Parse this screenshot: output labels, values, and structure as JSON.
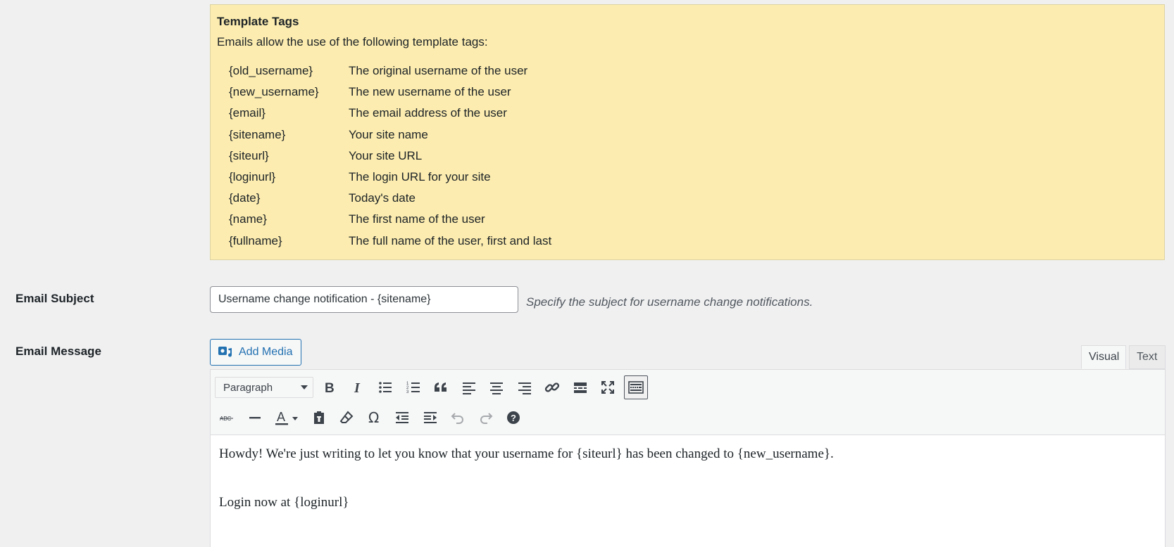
{
  "template_tags": {
    "title": "Template Tags",
    "intro": "Emails allow the use of the following template tags:",
    "tags": [
      {
        "tag": "{old_username}",
        "desc": "The original username of the user"
      },
      {
        "tag": "{new_username}",
        "desc": "The new username of the user"
      },
      {
        "tag": "{email}",
        "desc": "The email address of the user"
      },
      {
        "tag": "{sitename}",
        "desc": "Your site name"
      },
      {
        "tag": "{siteurl}",
        "desc": "Your site URL"
      },
      {
        "tag": "{loginurl}",
        "desc": "The login URL for your site"
      },
      {
        "tag": "{date}",
        "desc": "Today's date"
      },
      {
        "tag": "{name}",
        "desc": "The first name of the user"
      },
      {
        "tag": "{fullname}",
        "desc": "The full name of the user, first and last"
      }
    ]
  },
  "email_subject": {
    "label": "Email Subject",
    "value": "Username change notification - {sitename}",
    "description": "Specify the subject for username change notifications."
  },
  "email_message": {
    "label": "Email Message",
    "add_media_label": "Add Media",
    "tabs": {
      "visual": "Visual",
      "text": "Text"
    },
    "format_select": "Paragraph",
    "paragraphs": [
      "Howdy! We're just writing to let you know that your username for {siteurl} has been changed to {new_username}.",
      "Login now at {loginurl}"
    ]
  },
  "colors": {
    "notice_bg": "#fcecaf",
    "accent": "#2271b1",
    "page_bg": "#f0f0f1"
  }
}
